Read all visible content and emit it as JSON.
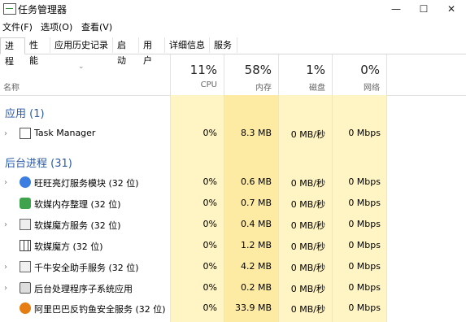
{
  "window": {
    "title": "任务管理器",
    "minimize": "—",
    "maximize": "☐",
    "close": "✕"
  },
  "menu": [
    "文件(F)",
    "选项(O)",
    "查看(V)"
  ],
  "tabs": [
    "进程",
    "性能",
    "应用历史记录",
    "启动",
    "用户",
    "详细信息",
    "服务"
  ],
  "active_tab": "进程",
  "columns": {
    "name": "名称",
    "cpu": {
      "percent": "11%",
      "label": "CPU"
    },
    "memory": {
      "percent": "58%",
      "label": "内存"
    },
    "disk": {
      "percent": "1%",
      "label": "磁盘"
    },
    "network": {
      "percent": "0%",
      "label": "网络"
    }
  },
  "sections": [
    {
      "title": "应用 (1)"
    },
    {
      "title": "后台进程 (31)"
    }
  ],
  "rows": [
    {
      "name": "Task Manager",
      "expandable": true,
      "icon": "task-manager-icon",
      "cpu": "0%",
      "memory": "8.3 MB",
      "disk": "0 MB/秒",
      "network": "0 Mbps"
    },
    {
      "name": "旺旺亮灯服务模块 (32 位)",
      "expandable": true,
      "icon": "wangwang-icon",
      "cpu": "0%",
      "memory": "0.6 MB",
      "disk": "0 MB/秒",
      "network": "0 Mbps"
    },
    {
      "name": "软媒内存整理 (32 位)",
      "expandable": false,
      "icon": "ram-cleaner-icon",
      "cpu": "0%",
      "memory": "0.7 MB",
      "disk": "0 MB/秒",
      "network": "0 Mbps"
    },
    {
      "name": "软媒魔方服务 (32 位)",
      "expandable": true,
      "icon": "cube-service-icon",
      "cpu": "0%",
      "memory": "0.4 MB",
      "disk": "0 MB/秒",
      "network": "0 Mbps"
    },
    {
      "name": "软媒魔方 (32 位)",
      "expandable": false,
      "icon": "grid-icon",
      "cpu": "0%",
      "memory": "1.2 MB",
      "disk": "0 MB/秒",
      "network": "0 Mbps"
    },
    {
      "name": "千牛安全助手服务 (32 位)",
      "expandable": true,
      "icon": "service-window-icon",
      "cpu": "0%",
      "memory": "4.2 MB",
      "disk": "0 MB/秒",
      "network": "0 Mbps"
    },
    {
      "name": "后台处理程序子系统应用",
      "expandable": true,
      "icon": "printer-icon",
      "cpu": "0%",
      "memory": "0.2 MB",
      "disk": "0 MB/秒",
      "network": "0 Mbps"
    },
    {
      "name": "阿里巴巴反钓鱼安全服务 (32 位)",
      "expandable": false,
      "icon": "shield-icon",
      "cpu": "0%",
      "memory": "33.9 MB",
      "disk": "0 MB/秒",
      "network": "0 Mbps"
    }
  ],
  "colors": {
    "cpu_bg": "#fff4c4",
    "mem_bg": "#fdeba3",
    "other_bg": "#fff4c4",
    "section": "#2a5aa8"
  }
}
